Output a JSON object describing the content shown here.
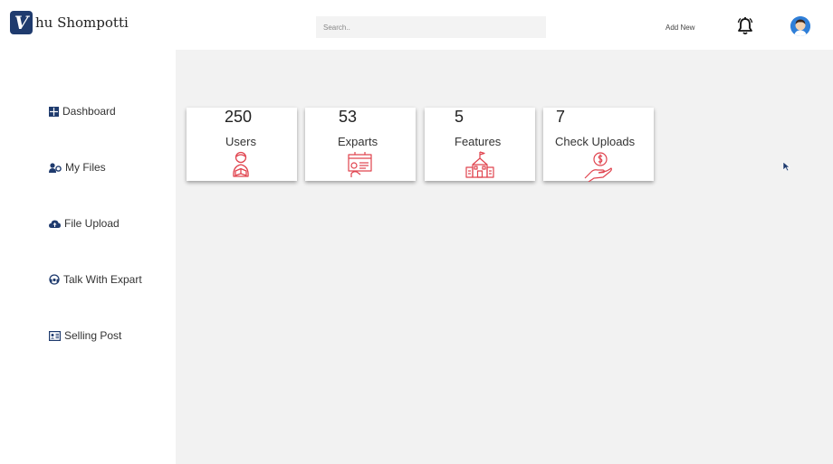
{
  "brand": {
    "initial": "V",
    "name": "hu Shompotti"
  },
  "search": {
    "placeholder": "Search.."
  },
  "header": {
    "add_new_label": "Add New"
  },
  "sidebar": {
    "items": [
      {
        "label": "Dashboard",
        "icon": "grid-icon"
      },
      {
        "label": "My Files",
        "icon": "users-icon"
      },
      {
        "label": "File Upload",
        "icon": "cloud-upload-icon"
      },
      {
        "label": "Talk With Expart",
        "icon": "headset-icon"
      },
      {
        "label": "Selling Post",
        "icon": "id-card-icon"
      }
    ]
  },
  "stats": [
    {
      "value": "250",
      "label": "Users",
      "icon": "reading-person-icon"
    },
    {
      "value": "53",
      "label": "Exparts",
      "icon": "presentation-board-icon"
    },
    {
      "value": "5",
      "label": "Features",
      "icon": "school-building-icon"
    },
    {
      "value": "7",
      "label": "Check Uploads",
      "icon": "hand-coin-icon"
    }
  ],
  "colors": {
    "brand": "#1f3b6e",
    "accent_icon": "#e0434e",
    "main_bg": "#f2f2f2",
    "avatar": "#2f7fd8"
  }
}
